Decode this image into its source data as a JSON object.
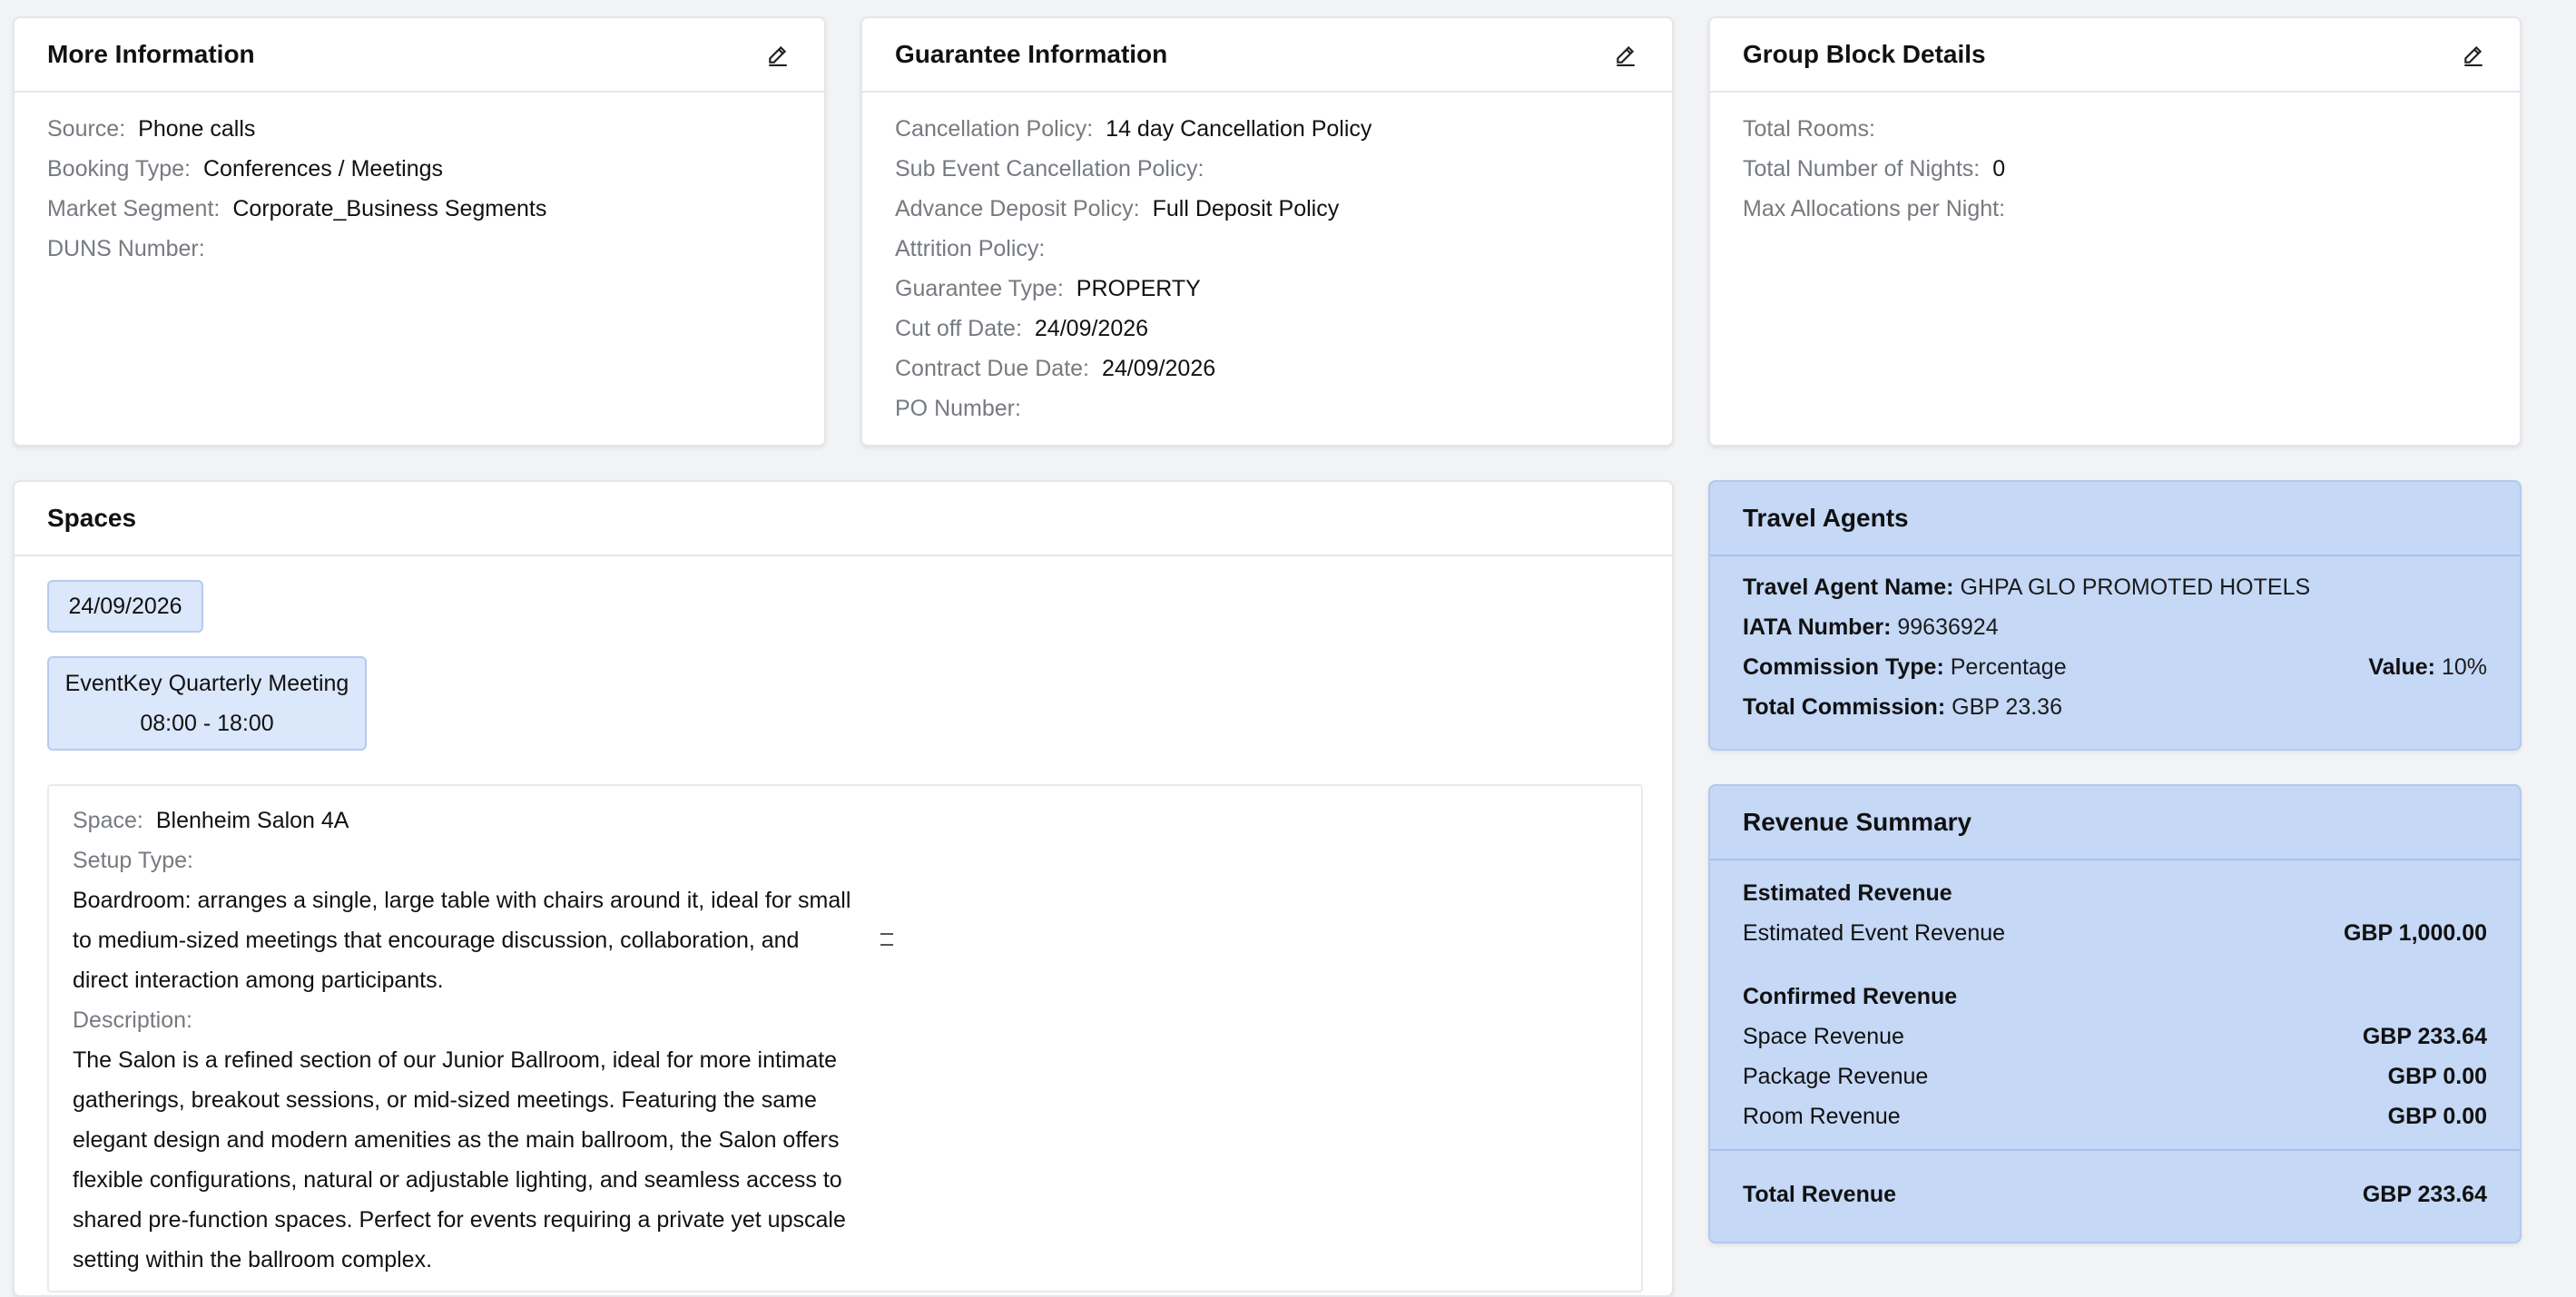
{
  "more_info": {
    "title": "More Information",
    "rows": [
      {
        "label": "Source:",
        "value": "Phone calls"
      },
      {
        "label": "Booking Type:",
        "value": "Conferences / Meetings"
      },
      {
        "label": "Market Segment:",
        "value": "Corporate_Business Segments"
      },
      {
        "label": "DUNS Number:",
        "value": ""
      }
    ]
  },
  "guarantee": {
    "title": "Guarantee Information",
    "rows": [
      {
        "label": "Cancellation Policy:",
        "value": "14 day Cancellation Policy"
      },
      {
        "label": "Sub Event Cancellation Policy:",
        "value": ""
      },
      {
        "label": "Advance Deposit Policy:",
        "value": "Full Deposit Policy"
      },
      {
        "label": "Attrition Policy:",
        "value": ""
      },
      {
        "label": "Guarantee Type:",
        "value": "PROPERTY"
      },
      {
        "label": "Cut off Date:",
        "value": "24/09/2026"
      },
      {
        "label": "Contract Due Date:",
        "value": "24/09/2026"
      },
      {
        "label": "PO Number:",
        "value": ""
      }
    ]
  },
  "group_block": {
    "title": "Group Block Details",
    "rows": [
      {
        "label": "Total Rooms:",
        "value": ""
      },
      {
        "label": "Total Number of Nights:",
        "value": "0"
      },
      {
        "label": "Max Allocations per Night:",
        "value": ""
      }
    ]
  },
  "spaces": {
    "title": "Spaces",
    "date_chip": "24/09/2026",
    "event_name": "EventKey Quarterly Meeting",
    "event_time": "08:00 - 18:00",
    "space_label": "Space:",
    "space_value": "Blenheim Salon 4A",
    "setup_label": "Setup Type:",
    "setup_text": "Boardroom: arranges a single, large table with chairs around it, ideal for small to medium-sized meetings that encourage discussion, collaboration, and direct interaction among participants.",
    "description_label": "Description:",
    "description_text": "The Salon is a refined section of our Junior Ballroom, ideal for more intimate gatherings, breakout sessions, or mid-sized meetings. Featuring the same elegant design and modern amenities as the main ballroom, the Salon offers flexible configurations, natural or adjustable lighting, and seamless access to shared pre-function spaces. Perfect for events requiring a private yet upscale setting within the ballroom complex."
  },
  "travel_agents": {
    "title": "Travel Agents",
    "agent_name_label": "Travel Agent Name:",
    "agent_name": "GHPA GLO PROMOTED HOTELS",
    "iata_label": "IATA Number:",
    "iata": "99636924",
    "commission_type_label": "Commission Type:",
    "commission_type": "Percentage",
    "value_label": "Value:",
    "value": "10%",
    "total_commission_label": "Total Commission:",
    "total_commission": "GBP 23.36"
  },
  "revenue": {
    "title": "Revenue Summary",
    "estimated_title": "Estimated Revenue",
    "estimated_event_label": "Estimated Event Revenue",
    "estimated_event_value": "GBP 1,000.00",
    "confirmed_title": "Confirmed Revenue",
    "space_label": "Space Revenue",
    "space_value": "GBP 233.64",
    "package_label": "Package Revenue",
    "package_value": "GBP 0.00",
    "room_label": "Room Revenue",
    "room_value": "GBP 0.00",
    "total_label": "Total Revenue",
    "total_value": "GBP 233.64"
  },
  "colors": {
    "page_bg": "#f2f3f5",
    "card_bg": "#ffffff",
    "blue_card_bg": "#c5d8f6",
    "chip_bg": "#dbe7fa",
    "label_gray": "#767a80"
  }
}
